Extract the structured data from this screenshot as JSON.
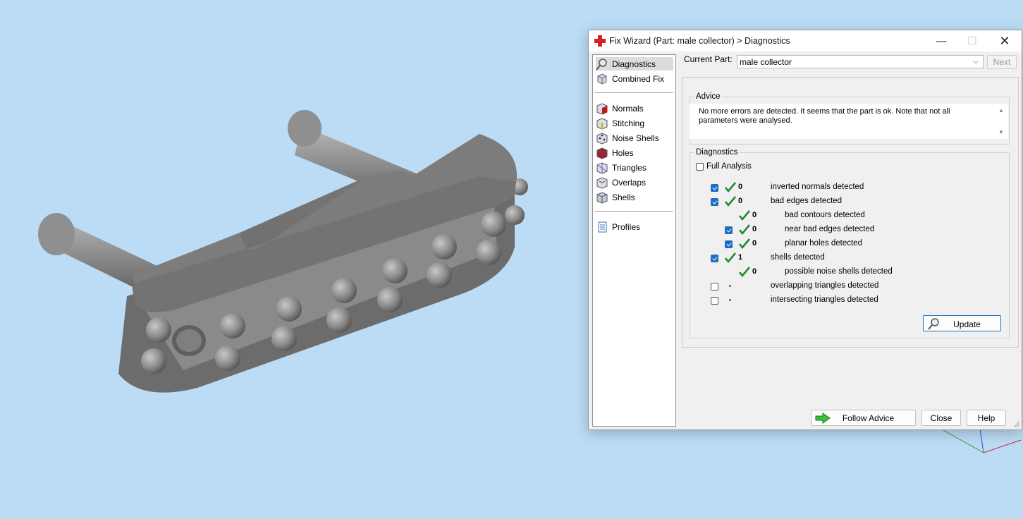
{
  "window": {
    "title": "Fix Wizard (Part: male collector) > Diagnostics",
    "min_glyph": "—",
    "max_glyph": "☐",
    "close_glyph": "✕"
  },
  "nav": {
    "items": [
      {
        "label": "Diagnostics",
        "icon": "magnifier-icon",
        "selected": true
      },
      {
        "label": "Combined Fix",
        "icon": "cube-stack-icon"
      },
      {
        "label": "Normals",
        "icon": "cube-red-face-icon"
      },
      {
        "label": "Stitching",
        "icon": "cube-yellow-edge-icon"
      },
      {
        "label": "Noise Shells",
        "icon": "cube-dots-icon"
      },
      {
        "label": "Holes",
        "icon": "cube-red-hole-icon"
      },
      {
        "label": "Triangles",
        "icon": "cube-triangle-icon"
      },
      {
        "label": "Overlaps",
        "icon": "cube-overlap-icon"
      },
      {
        "label": "Shells",
        "icon": "cube-shell-icon"
      },
      {
        "label": "Profiles",
        "icon": "document-icon"
      }
    ]
  },
  "current_part": {
    "label": "Current Part:",
    "value": "male collector",
    "next_label": "Next"
  },
  "advice": {
    "title": "Advice",
    "text": "No more errors are detected. It seems that the part is ok. Note that not all parameters were analysed."
  },
  "diagnostics": {
    "title": "Diagnostics",
    "full_analysis_label": "Full Analysis",
    "full_analysis_checked": false,
    "rows": [
      {
        "checkbox": true,
        "checked": true,
        "status": "ok",
        "count": "0",
        "label": "inverted normals detected",
        "indent": 0
      },
      {
        "checkbox": true,
        "checked": true,
        "status": "ok",
        "count": "0",
        "label": "bad edges detected",
        "indent": 0
      },
      {
        "checkbox": false,
        "checked": false,
        "status": "ok",
        "count": "0",
        "label": "bad contours detected",
        "indent": 1
      },
      {
        "checkbox": true,
        "checked": true,
        "status": "ok",
        "count": "0",
        "label": "near bad edges detected",
        "indent": 1
      },
      {
        "checkbox": true,
        "checked": true,
        "status": "ok",
        "count": "0",
        "label": "planar holes detected",
        "indent": 1
      },
      {
        "checkbox": true,
        "checked": true,
        "status": "ok",
        "count": "1",
        "label": "shells detected",
        "indent": 0
      },
      {
        "checkbox": false,
        "checked": false,
        "status": "ok",
        "count": "0",
        "label": "possible noise shells detected",
        "indent": 1
      },
      {
        "checkbox": true,
        "checked": false,
        "status": "pending",
        "count": "",
        "label": "overlapping triangles detected",
        "indent": 0
      },
      {
        "checkbox": true,
        "checked": false,
        "status": "pending",
        "count": "",
        "label": "intersecting triangles detected",
        "indent": 0
      }
    ],
    "update_label": "Update"
  },
  "buttons": {
    "follow_advice": "Follow Advice",
    "close": "Close",
    "help": "Help"
  },
  "colors": {
    "viewport_bg": "#bcdcf6",
    "accent": "#1d6dc4",
    "check_green": "#1e8a2e"
  }
}
